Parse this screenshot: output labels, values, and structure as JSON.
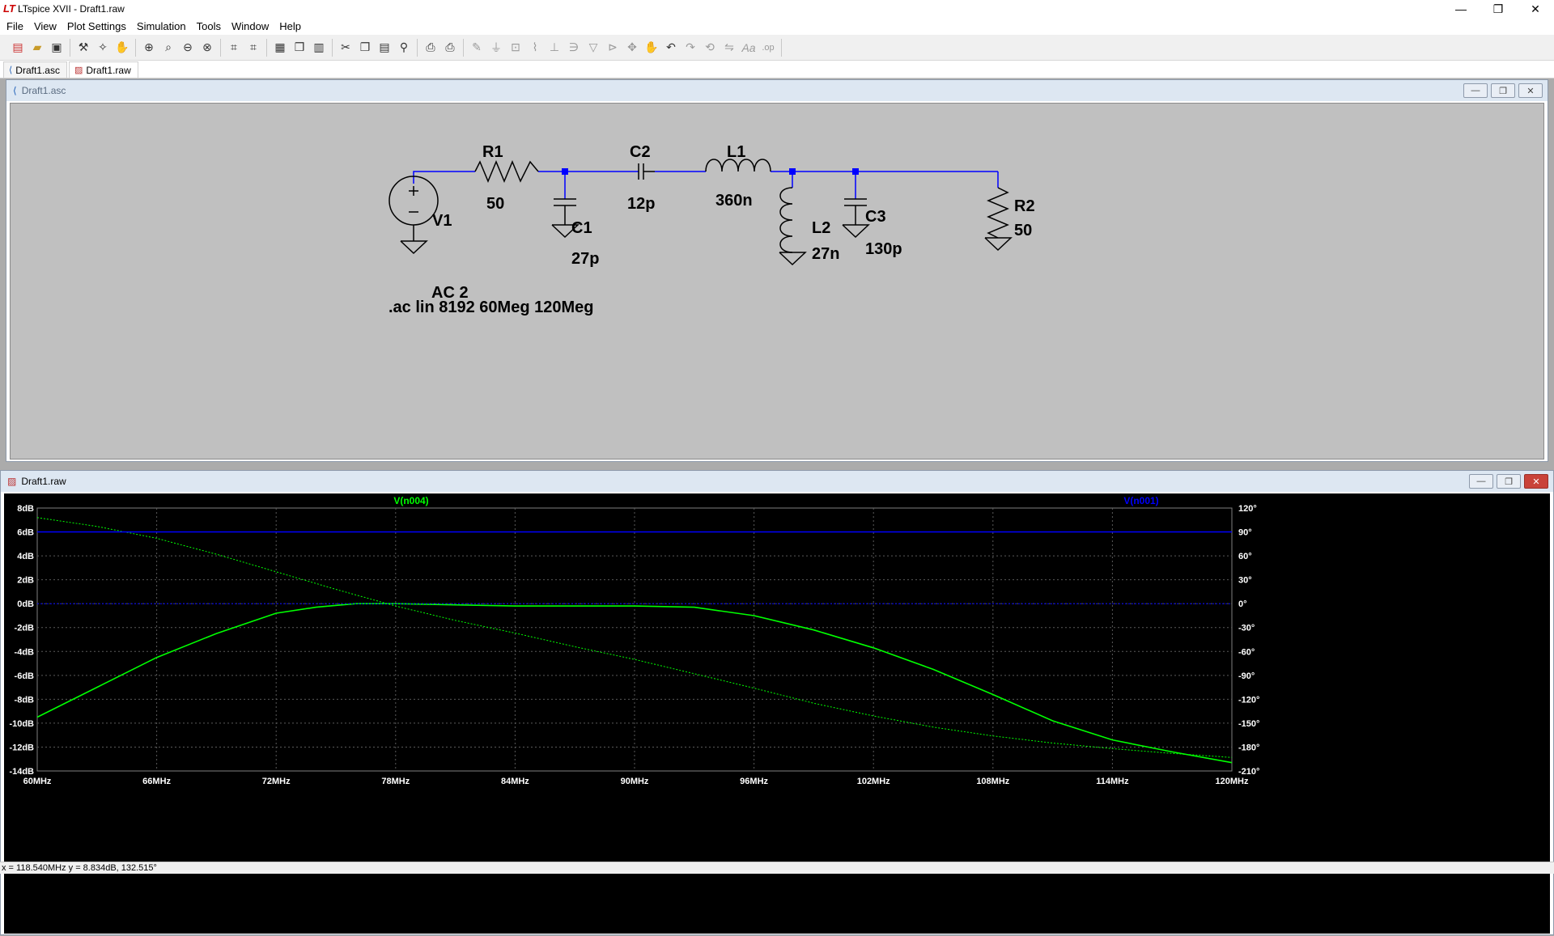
{
  "window": {
    "title": "LTspice XVII - Draft1.raw",
    "controls": [
      "—",
      "❐",
      "✕"
    ]
  },
  "menu": [
    "File",
    "View",
    "Plot Settings",
    "Simulation",
    "Tools",
    "Window",
    "Help"
  ],
  "toolbar": {
    "icons": [
      "new-schematic",
      "open",
      "save",
      "control-panel",
      "run",
      "halt",
      "zoom-in",
      "pan",
      "zoom-out",
      "zoom-fit",
      "autoscale-y",
      "autoscale-x",
      "tile-horizontal",
      "cascade",
      "tile-vertical",
      "cut",
      "copy",
      "paste",
      "find",
      "print-setup",
      "print",
      "wire",
      "ground",
      "label-net",
      "resistor",
      "capacitor",
      "inductor",
      "diode",
      "component",
      "move",
      "drag",
      "undo",
      "redo",
      "rotate",
      "mirror",
      "text",
      "spice-directive"
    ]
  },
  "tabs": [
    {
      "label": "Draft1.asc",
      "active": false
    },
    {
      "label": "Draft1.raw",
      "active": true
    }
  ],
  "schematic": {
    "title": "Draft1.asc",
    "components": {
      "R1": {
        "name": "R1",
        "value": "50"
      },
      "C2": {
        "name": "C2",
        "value": "12p"
      },
      "L1": {
        "name": "L1",
        "value": "360n"
      },
      "V1": {
        "name": "V1",
        "value": "AC 2"
      },
      "C1": {
        "name": "C1",
        "value": "27p"
      },
      "L2": {
        "name": "L2",
        "value": "27n"
      },
      "C3": {
        "name": "C3",
        "value": "130p"
      },
      "R2": {
        "name": "R2",
        "value": "50"
      }
    },
    "directive": ".ac lin 8192 60Meg 120Meg",
    "colors": {
      "wire": "#0000ff",
      "component": "#000000",
      "background": "#c0c0c0",
      "node": "#0000ff"
    }
  },
  "plot": {
    "title": "Draft1.raw",
    "trace_labels": [
      {
        "name": "V(n004)",
        "color": "#00ff00"
      },
      {
        "name": "V(n001)",
        "color": "#0000ff"
      }
    ]
  },
  "chart_data": {
    "type": "line",
    "title": "",
    "xlabel": "",
    "ylabel": "",
    "x_ticks": [
      "60MHz",
      "66MHz",
      "72MHz",
      "78MHz",
      "84MHz",
      "90MHz",
      "96MHz",
      "102MHz",
      "108MHz",
      "114MHz",
      "120MHz"
    ],
    "y_left_ticks": [
      "8dB",
      "6dB",
      "4dB",
      "2dB",
      "0dB",
      "-2dB",
      "-4dB",
      "-6dB",
      "-8dB",
      "-10dB",
      "-12dB",
      "-14dB"
    ],
    "y_right_ticks": [
      "120°",
      "90°",
      "60°",
      "30°",
      "0°",
      "-30°",
      "-60°",
      "-90°",
      "-120°",
      "-150°",
      "-180°",
      "-210°"
    ],
    "xlim": [
      60,
      120
    ],
    "ylim_left": [
      -14,
      8
    ],
    "ylim_right": [
      -210,
      120
    ],
    "grid": true,
    "series": [
      {
        "name": "V(n004)",
        "kind": "magnitude_dB",
        "axis": "left",
        "color": "#00ff00",
        "x": [
          60,
          63,
          66,
          69,
          72,
          74,
          76,
          78,
          81,
          84,
          87,
          90,
          93,
          96,
          99,
          102,
          105,
          108,
          111,
          114,
          117,
          120
        ],
        "y": [
          -9.5,
          -7.0,
          -4.5,
          -2.5,
          -0.8,
          -0.3,
          0.0,
          0.0,
          -0.1,
          -0.2,
          -0.2,
          -0.2,
          -0.3,
          -1.0,
          -2.2,
          -3.7,
          -5.5,
          -7.6,
          -9.8,
          -11.4,
          -12.4,
          -13.3
        ]
      },
      {
        "name": "V(n004)",
        "kind": "phase_deg",
        "axis": "right",
        "color": "#00ff00",
        "x": [
          60,
          63,
          66,
          69,
          72,
          75,
          78,
          81,
          84,
          87,
          90,
          93,
          96,
          99,
          102,
          105,
          108,
          111,
          114,
          117,
          120
        ],
        "y": [
          108,
          97,
          82,
          62,
          40,
          18,
          -3,
          -21,
          -37,
          -54,
          -70,
          -88,
          -106,
          -125,
          -141,
          -155,
          -166,
          -175,
          -182,
          -188,
          -193
        ]
      },
      {
        "name": "V(n001)",
        "kind": "magnitude_dB",
        "axis": "left",
        "color": "#0000ff",
        "x": [
          60,
          120
        ],
        "y": [
          6.0,
          6.0
        ]
      },
      {
        "name": "V(n001)",
        "kind": "phase_deg",
        "axis": "right",
        "color": "#0000ff",
        "x": [
          60,
          120
        ],
        "y": [
          0,
          0
        ]
      }
    ]
  },
  "status": {
    "cursor": "x = 118.540MHz    y = 8.834dB, 132.515°"
  }
}
